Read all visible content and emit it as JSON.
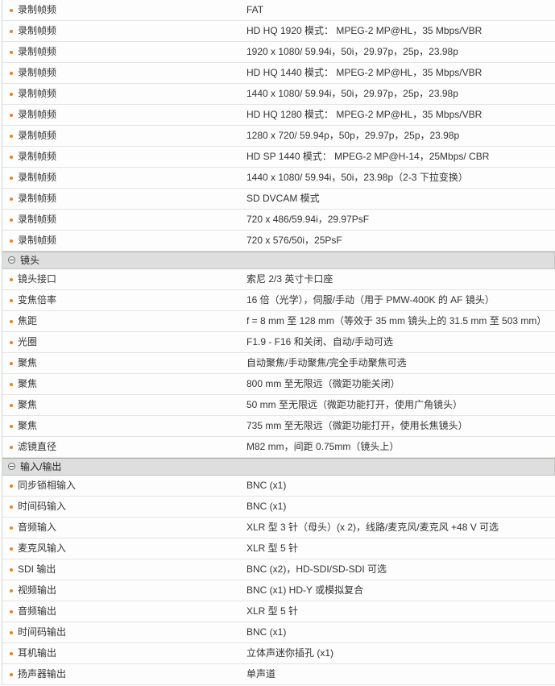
{
  "colors": {
    "bullet": "#e8821e",
    "header_bg": "#dedede",
    "row_line": "#e4e4e4",
    "text": "#333333"
  },
  "icons": {
    "bullet": "bullet-icon",
    "collapse": "collapse-icon"
  },
  "recording": {
    "rows": [
      {
        "label": "录制帧频",
        "value": "FAT"
      },
      {
        "label": "录制帧频",
        "value": "HD HQ 1920 模式： MPEG-2 MP@HL，35 Mbps/VBR"
      },
      {
        "label": "录制帧频",
        "value": "1920 x 1080/ 59.94i，50i，29.97p，25p，23.98p"
      },
      {
        "label": "录制帧频",
        "value": "HD HQ 1440 模式： MPEG-2 MP@HL，35 Mbps/VBR"
      },
      {
        "label": "录制帧频",
        "value": "1440 x 1080/ 59.94i，50i，29.97p，25p，23.98p"
      },
      {
        "label": "录制帧频",
        "value": "HD HQ 1280 模式： MPEG-2 MP@HL，35 Mbps/VBR"
      },
      {
        "label": "录制帧频",
        "value": "1280 x 720/ 59.94p，50p，29.97p，25p，23.98p"
      },
      {
        "label": "录制帧频",
        "value": "HD SP 1440 模式： MPEG-2 MP@H-14，25Mbps/ CBR"
      },
      {
        "label": "录制帧频",
        "value": "1440 x 1080/ 59.94i，50i，23.98p（2-3 下拉变换）"
      },
      {
        "label": "录制帧频",
        "value": "SD DVCAM 模式"
      },
      {
        "label": "录制帧频",
        "value": "720 x 486/59.94i，29.97PsF"
      },
      {
        "label": "录制帧频",
        "value": "720 x 576/50i，25PsF"
      }
    ]
  },
  "lens": {
    "title": "镜头",
    "rows": [
      {
        "label": "镜头接口",
        "value": "索尼 2/3 英寸卡口座"
      },
      {
        "label": "变焦倍率",
        "value": "16 倍（光学），伺服/手动（用于 PMW-400K 的 AF 镜头）"
      },
      {
        "label": "焦距",
        "value": "f = 8 mm 至 128 mm（等效于 35 mm 镜头上的 31.5 mm 至 503 mm）"
      },
      {
        "label": "光圈",
        "value": "F1.9 - F16 和关闭、自动/手动可选"
      },
      {
        "label": "聚焦",
        "value": "自动聚焦/手动聚焦/完全手动聚焦可选"
      },
      {
        "label": "聚焦",
        "value": "800 mm 至无限远（微距功能关闭）"
      },
      {
        "label": "聚焦",
        "value": "50 mm 至无限远（微距功能打开，使用广角镜头）"
      },
      {
        "label": "聚焦",
        "value": "735 mm 至无限远（微距功能打开，使用长焦镜头）"
      },
      {
        "label": "滤镜直径",
        "value": "M82 mm，间距 0.75mm（镜头上）"
      }
    ]
  },
  "io": {
    "title": "输入/输出",
    "rows": [
      {
        "label": "同步锁相输入",
        "value": "BNC (x1)"
      },
      {
        "label": "时间码输入",
        "value": "BNC (x1)"
      },
      {
        "label": "音频输入",
        "value": "XLR 型 3 针（母头）(x 2)，线路/麦克风/麦克风 +48 V 可选"
      },
      {
        "label": "麦克风输入",
        "value": "XLR 型 5 针"
      },
      {
        "label": "SDI 输出",
        "value": "BNC (x2)，HD-SDI/SD-SDI 可选"
      },
      {
        "label": "视频输出",
        "value": "BNC (x1) HD-Y 或模拟复合"
      },
      {
        "label": "音频输出",
        "value": "XLR 型 5 针"
      },
      {
        "label": "时间码输出",
        "value": "BNC (x1)"
      },
      {
        "label": "耳机输出",
        "value": "立体声迷你插孔 (x1)"
      },
      {
        "label": "扬声器输出",
        "value": "单声道"
      }
    ]
  }
}
